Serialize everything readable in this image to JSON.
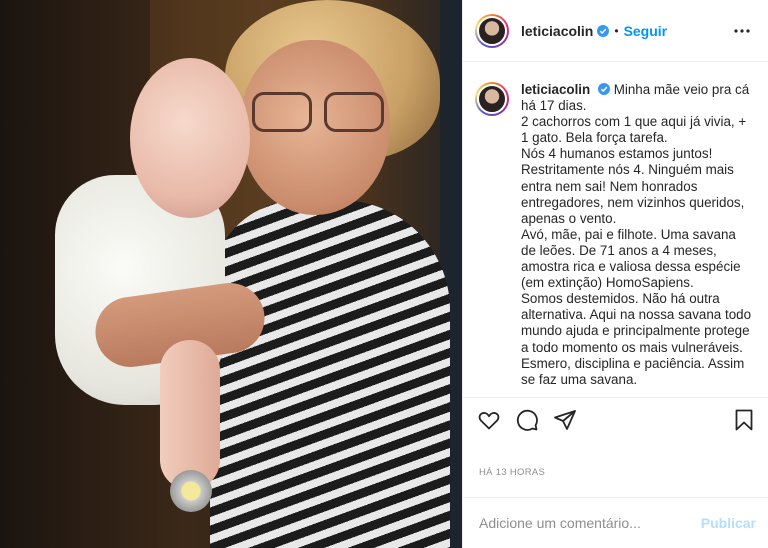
{
  "post": {
    "image_alt": "Foto de avó segurando bebê",
    "username": "leticiacolin",
    "verified": true,
    "follow_label": "Seguir",
    "separator": "•",
    "more_icon": "more-horizontal-icon",
    "caption_lines": [
      "Minha mãe veio pra cá há 17 dias.",
      "2 cachorros com 1 que aqui já vivia, + 1 gato. Bela força tarefa.",
      "Nós 4 humanos estamos juntos! Restritamente nós 4. Ninguém mais entra nem sai! Nem honrados entregadores, nem vizinhos queridos, apenas o vento.",
      "Avó, mãe, pai e filhote. Uma savana de leões. De 71 anos a 4 meses, amostra rica e valiosa dessa espécie (em extinção) HomoSapiens.",
      "Somos destemidos. Não há outra alternativa. Aqui na nossa savana todo mundo ajuda e principalmente protege a todo momento os mais vulneráveis. Esmero, disciplina e paciência. Assim se faz uma savana."
    ],
    "actions": {
      "like_icon": "heart-icon",
      "comment_icon": "comment-icon",
      "share_icon": "share-icon",
      "save_icon": "bookmark-icon"
    },
    "timestamp": "HÁ 13 HORAS",
    "comment": {
      "placeholder": "Adicione um comentário...",
      "value": "",
      "publish_label": "Publicar"
    }
  },
  "colors": {
    "accent": "#0095f6",
    "publish_disabled": "#b2dffc",
    "muted": "#8e8e8e",
    "text": "#262626"
  }
}
